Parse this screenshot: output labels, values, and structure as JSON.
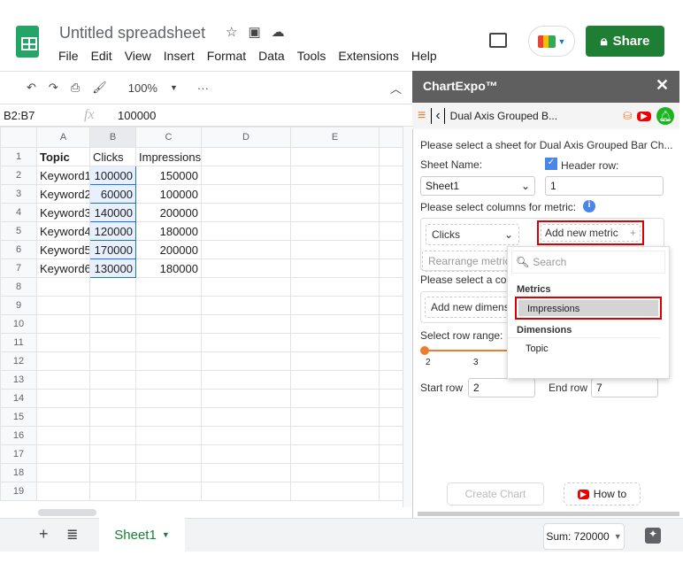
{
  "app": {
    "title": "Untitled spreadsheet",
    "menu": [
      "File",
      "Edit",
      "View",
      "Insert",
      "Format",
      "Data",
      "Tools",
      "Extensions",
      "Help"
    ],
    "share_label": "Share"
  },
  "toolbar": {
    "zoom": "100%",
    "more": "···"
  },
  "formula_bar": {
    "name_box": "B2:B7",
    "fx": "fx",
    "value": "100000"
  },
  "grid": {
    "columns": [
      "A",
      "B",
      "C",
      "D",
      "E"
    ],
    "rows": [
      [
        "Topic",
        "Clicks",
        "Impressions"
      ],
      [
        "Keyword1",
        "100000",
        "150000"
      ],
      [
        "Keyword2",
        "60000",
        "100000"
      ],
      [
        "Keyword3",
        "140000",
        "200000"
      ],
      [
        "Keyword4",
        "120000",
        "180000"
      ],
      [
        "Keyword5",
        "170000",
        "200000"
      ],
      [
        "Keyword6",
        "130000",
        "180000"
      ]
    ],
    "row_numbers": [
      "1",
      "2",
      "3",
      "4",
      "5",
      "6",
      "7",
      "8",
      "9",
      "10",
      "11",
      "12",
      "13",
      "14",
      "15",
      "16",
      "17",
      "18",
      "19"
    ]
  },
  "bottom": {
    "sheet_tab": "Sheet1",
    "sum": "Sum: 720000"
  },
  "panel": {
    "title": "ChartExpo™",
    "chart_name": "Dual Axis Grouped B...",
    "select_sheet": "Please select a sheet for Dual Axis Grouped Bar Ch...",
    "sheet_name_label": "Sheet Name:",
    "sheet_name": "Sheet1",
    "header_row_label": "Header row:",
    "header_row": "1",
    "metric_label": "Please select columns for metric:",
    "metric_selected": "Clicks",
    "add_metric": "Add new metric",
    "rearrange": "Rearrange metric",
    "dimension_label": "Please select a colu",
    "add_dimension": "Add new dimensio",
    "row_range_label": "Select row range:",
    "range_ticks": [
      "2",
      "3"
    ],
    "range_fraction": 0,
    "start_row_label": "Start row",
    "start_row": "2",
    "end_row_label": "End row",
    "end_row": "7",
    "create_chart": "Create Chart",
    "how_to": "How to"
  },
  "dropdown": {
    "search_placeholder": "Search",
    "metrics_heading": "Metrics",
    "metrics": [
      "Impressions"
    ],
    "dimensions_heading": "Dimensions",
    "dimensions": [
      "Topic"
    ]
  },
  "colors": {
    "share": "#1e7e34",
    "accent": "#ed7d31",
    "highlight": "#d00000",
    "panel_header": "#5f5f5f"
  }
}
